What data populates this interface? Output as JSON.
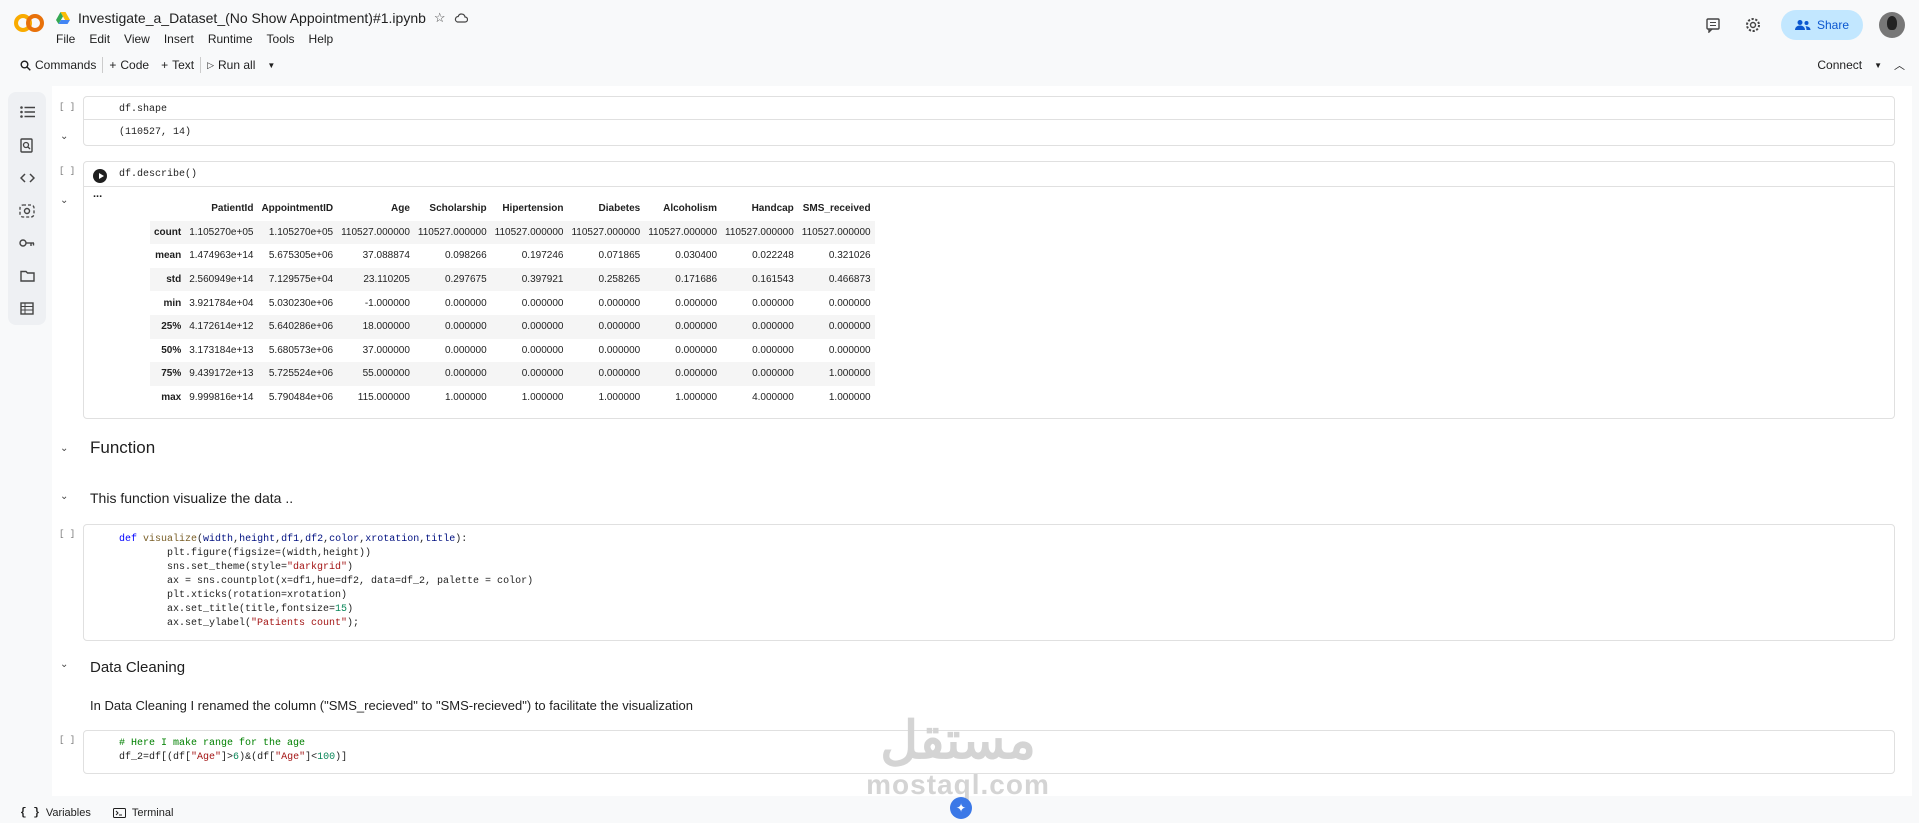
{
  "header": {
    "title": "Investigate_a_Dataset_(No Show Appointment)#1.ipynb",
    "menu": [
      "File",
      "Edit",
      "View",
      "Insert",
      "Runtime",
      "Tools",
      "Help"
    ],
    "share_label": "Share"
  },
  "toolbar": {
    "commands": "Commands",
    "code": "Code",
    "text": "Text",
    "run_all": "Run all",
    "connect": "Connect"
  },
  "cells": {
    "bracket": "[ ]",
    "c1_code": "df.shape",
    "c1_output": "(110527, 14)",
    "c2_code": "df.describe()",
    "output_dots": "...",
    "md_function": "Function",
    "md_function_desc": "This function visualize the data ..",
    "md_cleaning": "Data Cleaning",
    "md_cleaning_desc": "In Data Cleaning I renamed the column (\"SMS_recieved\" to \"SMS-recieved\") to facilitate the visualization"
  },
  "describe_table": {
    "columns": [
      "",
      "PatientId",
      "AppointmentID",
      "Age",
      "Scholarship",
      "Hipertension",
      "Diabetes",
      "Alcoholism",
      "Handcap",
      "SMS_received"
    ],
    "rows": [
      [
        "count",
        "1.105270e+05",
        "1.105270e+05",
        "110527.000000",
        "110527.000000",
        "110527.000000",
        "110527.000000",
        "110527.000000",
        "110527.000000",
        "110527.000000"
      ],
      [
        "mean",
        "1.474963e+14",
        "5.675305e+06",
        "37.088874",
        "0.098266",
        "0.197246",
        "0.071865",
        "0.030400",
        "0.022248",
        "0.321026"
      ],
      [
        "std",
        "2.560949e+14",
        "7.129575e+04",
        "23.110205",
        "0.297675",
        "0.397921",
        "0.258265",
        "0.171686",
        "0.161543",
        "0.466873"
      ],
      [
        "min",
        "3.921784e+04",
        "5.030230e+06",
        "-1.000000",
        "0.000000",
        "0.000000",
        "0.000000",
        "0.000000",
        "0.000000",
        "0.000000"
      ],
      [
        "25%",
        "4.172614e+12",
        "5.640286e+06",
        "18.000000",
        "0.000000",
        "0.000000",
        "0.000000",
        "0.000000",
        "0.000000",
        "0.000000"
      ],
      [
        "50%",
        "3.173184e+13",
        "5.680573e+06",
        "37.000000",
        "0.000000",
        "0.000000",
        "0.000000",
        "0.000000",
        "0.000000",
        "0.000000"
      ],
      [
        "75%",
        "9.439172e+13",
        "5.725524e+06",
        "55.000000",
        "0.000000",
        "0.000000",
        "0.000000",
        "0.000000",
        "0.000000",
        "1.000000"
      ],
      [
        "max",
        "9.999816e+14",
        "5.790484e+06",
        "115.000000",
        "1.000000",
        "1.000000",
        "1.000000",
        "1.000000",
        "4.000000",
        "1.000000"
      ]
    ]
  },
  "code_visualize": [
    [
      [
        "def ",
        "kw"
      ],
      [
        "visualize",
        "fn"
      ],
      [
        "(",
        ""
      ],
      [
        "width",
        "var"
      ],
      [
        ",",
        ""
      ],
      [
        "height",
        "var"
      ],
      [
        ",",
        ""
      ],
      [
        "df1",
        "var"
      ],
      [
        ",",
        ""
      ],
      [
        "df2",
        "var"
      ],
      [
        ",",
        ""
      ],
      [
        "color",
        "var"
      ],
      [
        ",",
        ""
      ],
      [
        "xrotation",
        "var"
      ],
      [
        ",",
        ""
      ],
      [
        "title",
        "var"
      ],
      [
        "):",
        ""
      ]
    ],
    [
      [
        "        plt.figure(figsize=(width,height))",
        ""
      ]
    ],
    [
      [
        "        sns.set_theme(style=",
        ""
      ],
      [
        "\"darkgrid\"",
        "str"
      ],
      [
        ")",
        ""
      ]
    ],
    [
      [
        "        ax = sns.countplot(x=df1,hue=df2, data=df_2, palette = color)",
        ""
      ]
    ],
    [
      [
        "        plt.xticks(rotation=xrotation)",
        ""
      ]
    ],
    [
      [
        "        ax.set_title(title,fontsize=",
        ""
      ],
      [
        "15",
        "num"
      ],
      [
        ")",
        ""
      ]
    ],
    [
      [
        "        ax.set_ylabel(",
        ""
      ],
      [
        "\"Patients count\"",
        "str"
      ],
      [
        ");",
        ""
      ]
    ]
  ],
  "code_age": [
    [
      [
        "# Here I make range for the age",
        "cm"
      ]
    ],
    [
      [
        "df_2=df[(df[",
        ""
      ],
      [
        "\"Age\"",
        "str"
      ],
      [
        "]>",
        ""
      ],
      [
        "6",
        "num"
      ],
      [
        ")&(df[",
        ""
      ],
      [
        "\"Age\"",
        "str"
      ],
      [
        "]<",
        ""
      ],
      [
        "100",
        "num"
      ],
      [
        ")]",
        ""
      ]
    ]
  ],
  "bottombar": {
    "variables": "Variables",
    "terminal": "Terminal"
  },
  "watermark": {
    "arabic": "مستقل",
    "latin": "mostaql.com"
  },
  "colors": {
    "accent": "#0b57d0",
    "share_bg": "#c2e7ff",
    "gemini": "#3b78e7"
  }
}
